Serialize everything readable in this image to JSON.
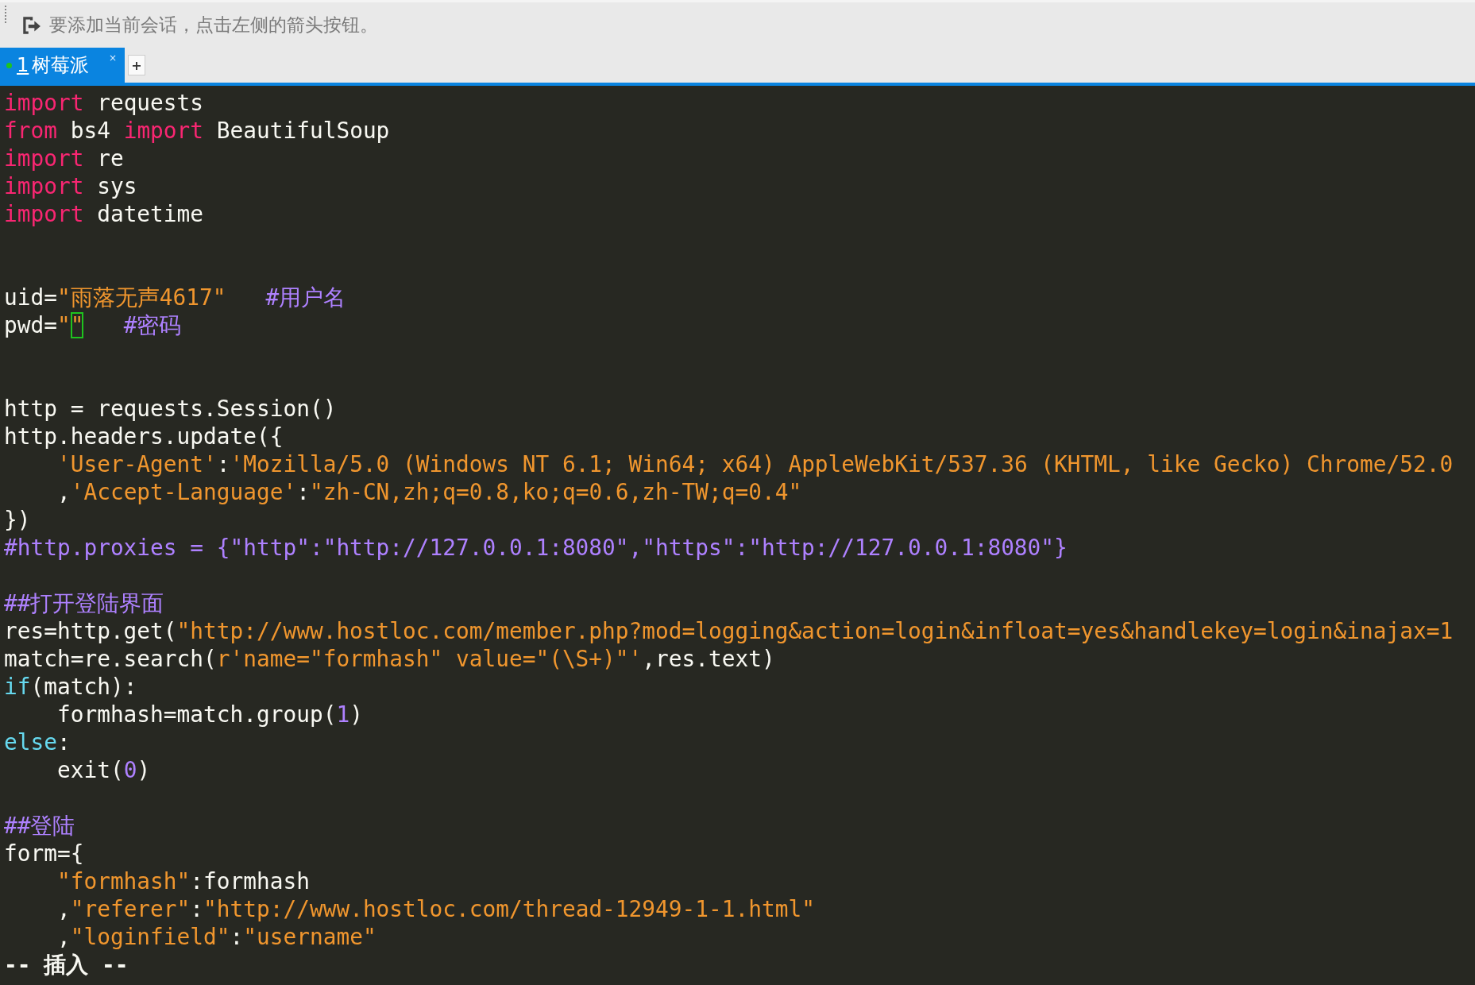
{
  "toolbar": {
    "hint": "要添加当前会话，点击左侧的箭头按钮。"
  },
  "tabs": [
    {
      "number": "1",
      "label": "树莓派",
      "selected": true,
      "connected": true,
      "close": "×"
    }
  ],
  "new_tab_button": "+",
  "editor": {
    "lines": [
      {
        "kind": "code",
        "segments": [
          {
            "kind": "keyword",
            "text": "import"
          },
          {
            "kind": "plain",
            "text": " requests"
          }
        ]
      },
      {
        "kind": "code",
        "segments": [
          {
            "kind": "keyword",
            "text": "from"
          },
          {
            "kind": "plain",
            "text": " bs4 "
          },
          {
            "kind": "keyword",
            "text": "import"
          },
          {
            "kind": "plain",
            "text": " BeautifulSoup"
          }
        ]
      },
      {
        "kind": "code",
        "segments": [
          {
            "kind": "keyword",
            "text": "import"
          },
          {
            "kind": "plain",
            "text": " re"
          }
        ]
      },
      {
        "kind": "code",
        "segments": [
          {
            "kind": "keyword",
            "text": "import"
          },
          {
            "kind": "plain",
            "text": " sys"
          }
        ]
      },
      {
        "kind": "code",
        "segments": [
          {
            "kind": "keyword",
            "text": "import"
          },
          {
            "kind": "plain",
            "text": " datetime"
          }
        ]
      },
      {
        "kind": "blank"
      },
      {
        "kind": "blank"
      },
      {
        "kind": "code",
        "segments": [
          {
            "kind": "plain",
            "text": "uid="
          },
          {
            "kind": "string",
            "text": "\"雨落无声4617\""
          },
          {
            "kind": "comment",
            "text": "   #用户名"
          }
        ]
      },
      {
        "kind": "code",
        "segments": [
          {
            "kind": "plain",
            "text": "pwd="
          },
          {
            "kind": "string",
            "text": "\""
          },
          {
            "kind": "string",
            "text": "\"",
            "cursor": true
          },
          {
            "kind": "comment",
            "text": "   #密码"
          }
        ]
      },
      {
        "kind": "blank"
      },
      {
        "kind": "blank"
      },
      {
        "kind": "code",
        "segments": [
          {
            "kind": "plain",
            "text": "http = requests.Session()"
          }
        ]
      },
      {
        "kind": "code",
        "segments": [
          {
            "kind": "plain",
            "text": "http.headers.update({"
          }
        ]
      },
      {
        "kind": "code",
        "segments": [
          {
            "kind": "string",
            "text": "    'User-Agent'"
          },
          {
            "kind": "plain",
            "text": ":"
          },
          {
            "kind": "string",
            "text": "'Mozilla/5.0 (Windows NT 6.1; Win64; x64) AppleWebKit/537.36 (KHTML, like Gecko) Chrome/52.0"
          }
        ]
      },
      {
        "kind": "code",
        "segments": [
          {
            "kind": "plain",
            "text": "    ,"
          },
          {
            "kind": "string",
            "text": "'Accept-Language'"
          },
          {
            "kind": "plain",
            "text": ":"
          },
          {
            "kind": "string",
            "text": "\"zh-CN,zh;q=0.8,ko;q=0.6,zh-TW;q=0.4\""
          }
        ]
      },
      {
        "kind": "code",
        "segments": [
          {
            "kind": "plain",
            "text": "})"
          }
        ]
      },
      {
        "kind": "code",
        "segments": [
          {
            "kind": "comment",
            "text": "#http.proxies = {\"http\":\"http://127.0.0.1:8080\",\"https\":\"http://127.0.0.1:8080\"}"
          }
        ]
      },
      {
        "kind": "blank"
      },
      {
        "kind": "code",
        "segments": [
          {
            "kind": "comment",
            "text": "##打开登陆界面"
          }
        ]
      },
      {
        "kind": "code",
        "segments": [
          {
            "kind": "plain",
            "text": "res=http.get("
          },
          {
            "kind": "string",
            "text": "\"http://www.hostloc.com/member.php?mod=logging&action=login&infloat=yes&handlekey=login&inajax=1"
          }
        ]
      },
      {
        "kind": "code",
        "segments": [
          {
            "kind": "plain",
            "text": "match=re.search("
          },
          {
            "kind": "string",
            "text": "r'name=\"formhash\" value=\"(\\S+)\"'"
          },
          {
            "kind": "plain",
            "text": ",res.text)"
          }
        ]
      },
      {
        "kind": "code",
        "segments": [
          {
            "kind": "control",
            "text": "if"
          },
          {
            "kind": "plain",
            "text": "(match):"
          }
        ]
      },
      {
        "kind": "code",
        "segments": [
          {
            "kind": "plain",
            "text": "    formhash=match.group("
          },
          {
            "kind": "number",
            "text": "1"
          },
          {
            "kind": "plain",
            "text": ")"
          }
        ]
      },
      {
        "kind": "code",
        "segments": [
          {
            "kind": "control",
            "text": "else"
          },
          {
            "kind": "plain",
            "text": ":"
          }
        ]
      },
      {
        "kind": "code",
        "segments": [
          {
            "kind": "plain",
            "text": "    exit("
          },
          {
            "kind": "number",
            "text": "0"
          },
          {
            "kind": "plain",
            "text": ")"
          }
        ]
      },
      {
        "kind": "blank"
      },
      {
        "kind": "code",
        "segments": [
          {
            "kind": "comment",
            "text": "##登陆"
          }
        ]
      },
      {
        "kind": "code",
        "segments": [
          {
            "kind": "plain",
            "text": "form={"
          }
        ]
      },
      {
        "kind": "code",
        "segments": [
          {
            "kind": "string",
            "text": "    \"formhash\""
          },
          {
            "kind": "plain",
            "text": ":formhash"
          }
        ]
      },
      {
        "kind": "code",
        "segments": [
          {
            "kind": "plain",
            "text": "    ,"
          },
          {
            "kind": "string",
            "text": "\"referer\""
          },
          {
            "kind": "plain",
            "text": ":"
          },
          {
            "kind": "string",
            "text": "\"http://www.hostloc.com/thread-12949-1-1.html\""
          }
        ]
      },
      {
        "kind": "code",
        "segments": [
          {
            "kind": "plain",
            "text": "    ,"
          },
          {
            "kind": "string",
            "text": "\"loginfield\""
          },
          {
            "kind": "plain",
            "text": ":"
          },
          {
            "kind": "string",
            "text": "\"username\""
          }
        ]
      }
    ],
    "mode": "-- 插入 --"
  }
}
